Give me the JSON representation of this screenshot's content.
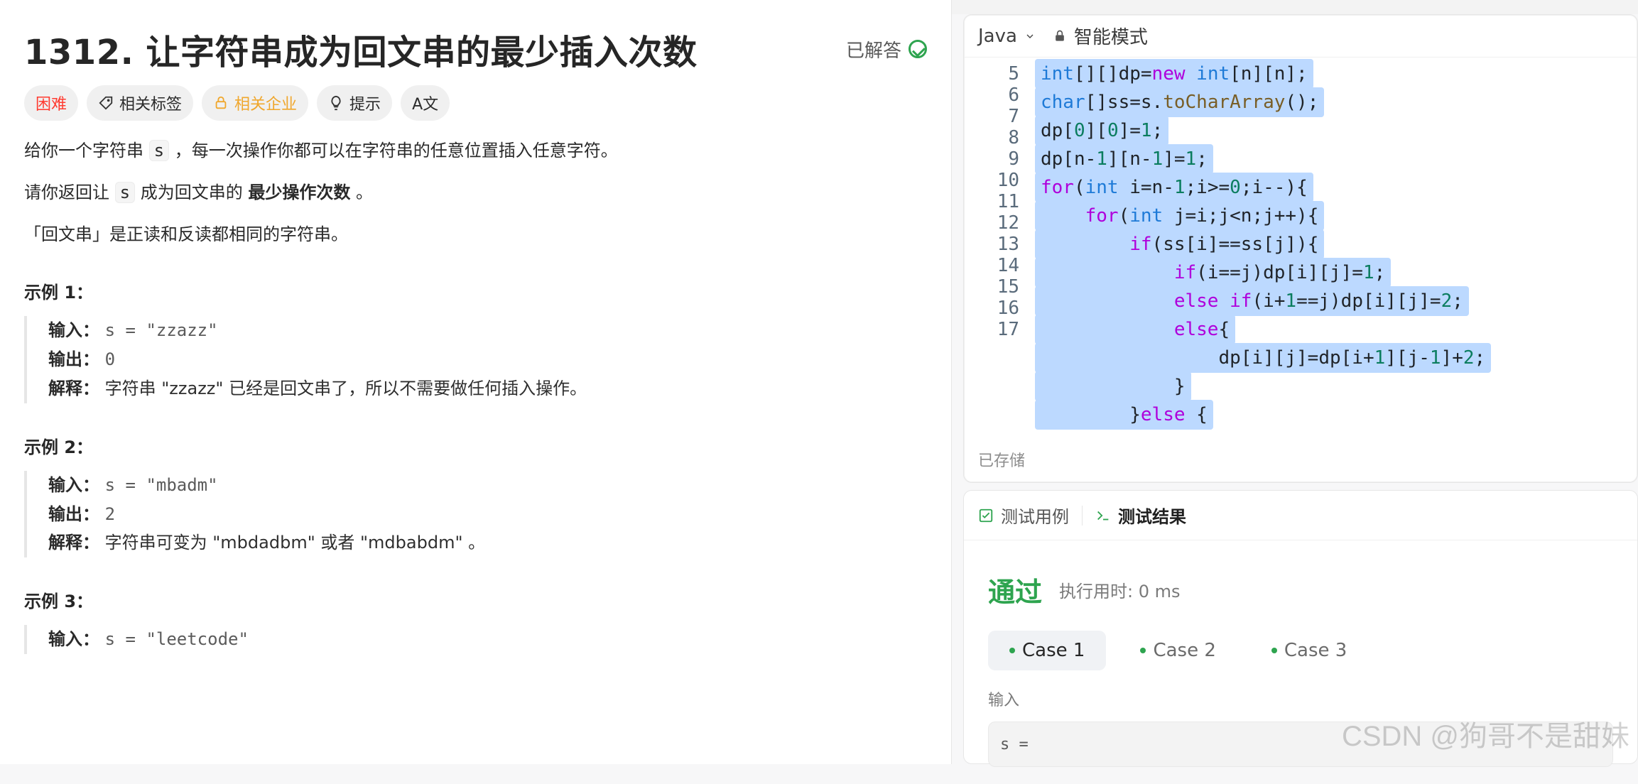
{
  "problem": {
    "title": "1312. 让字符串成为回文串的最少插入次数",
    "solved_label": "已解答",
    "tags": {
      "difficulty": "困难",
      "related_tags": "相关标签",
      "related_companies": "相关企业",
      "hint": "提示",
      "font_toggle": "A文"
    },
    "description": {
      "para1_prefix": "给你一个字符串",
      "para1_var": "s",
      "para1_suffix": "，每一次操作你都可以在字符串的任意位置插入任意字符。",
      "para2_prefix": "请你返回让",
      "para2_var": "s",
      "para2_mid": "成为回文串的",
      "para2_bold": "最少操作次数",
      "para2_end": "。",
      "para3": "「回文串」是正读和反读都相同的字符串。"
    },
    "examples": [
      {
        "title": "示例 1：",
        "input_label": "输入：",
        "input_value": "s = \"zzazz\"",
        "output_label": "输出：",
        "output_value": "0",
        "explain_label": "解释：",
        "explain_value": "字符串 \"zzazz\" 已经是回文串了，所以不需要做任何插入操作。"
      },
      {
        "title": "示例 2：",
        "input_label": "输入：",
        "input_value": "s = \"mbadm\"",
        "output_label": "输出：",
        "output_value": "2",
        "explain_label": "解释：",
        "explain_value": "字符串可变为 \"mbdadbm\" 或者 \"mdbabdm\" 。"
      },
      {
        "title": "示例 3：",
        "input_label": "输入：",
        "input_value": "s = \"leetcode\""
      }
    ]
  },
  "editor": {
    "language": "Java",
    "mode": "智能模式",
    "saved": "已存储",
    "lines": [
      {
        "num": "5",
        "html": "<span class='hl'><span class='type'>int</span>[][]dp=<span class='kw'>new</span> <span class='type'>int</span>[n][n];</span>"
      },
      {
        "num": "6",
        "html": "<span class='hl'><span class='type'>char</span>[]ss=s.<span class='fn'>toCharArray</span>();</span>"
      },
      {
        "num": "7",
        "html": "<span class='hl'>dp[<span class='num'>0</span>][<span class='num'>0</span>]=<span class='num'>1</span>;</span>"
      },
      {
        "num": "8",
        "html": "<span class='hl'>dp[n-<span class='num'>1</span>][n-<span class='num'>1</span>]=<span class='num'>1</span>;</span>"
      },
      {
        "num": "9",
        "html": "<span class='hl'><span class='kw'>for</span>(<span class='type'>int</span> i=n-<span class='num'>1</span>;i>=<span class='num'>0</span>;i--){</span>"
      },
      {
        "num": "10",
        "html": "<span class='hl'>    <span class='kw'>for</span>(<span class='type'>int</span> j=i;j&lt;n;j++){</span>"
      },
      {
        "num": "11",
        "html": "<span class='hl'>        <span class='kw'>if</span>(ss[i]==ss[j]){</span>"
      },
      {
        "num": "12",
        "html": "<span class='hl'>            <span class='kw'>if</span>(i==j)dp[i][j]=<span class='num'>1</span>;</span>"
      },
      {
        "num": "13",
        "html": "<span class='hl'>            <span class='kw'>else</span> <span class='kw'>if</span>(i+<span class='num'>1</span>==j)dp[i][j]=<span class='num'>2</span>;</span>"
      },
      {
        "num": "14",
        "html": "<span class='hl'>            <span class='kw'>else</span>{</span>"
      },
      {
        "num": "15",
        "html": "<span class='hl'>                dp[i][j]=dp[i+<span class='num'>1</span>][j-<span class='num'>1</span>]+<span class='num'>2</span>;</span>"
      },
      {
        "num": "16",
        "html": "<span class='hl'>            }</span>"
      },
      {
        "num": "17",
        "html": "<span class='hl'>        }<span class='kw'>else</span> {</span>"
      }
    ]
  },
  "results": {
    "tab_testcases": "测试用例",
    "tab_results": "测试结果",
    "status": "通过",
    "runtime": "执行用时: 0 ms",
    "cases": [
      "Case 1",
      "Case 2",
      "Case 3"
    ],
    "input_label": "输入",
    "input_preview": "s ="
  },
  "watermark": "CSDN @狗哥不是甜妹",
  "colors": {
    "accent_green": "#2ea44f",
    "difficulty_hard": "#ff3b30",
    "company_gold": "#f0a72d",
    "highlight_bg": "#bcd9ff"
  }
}
